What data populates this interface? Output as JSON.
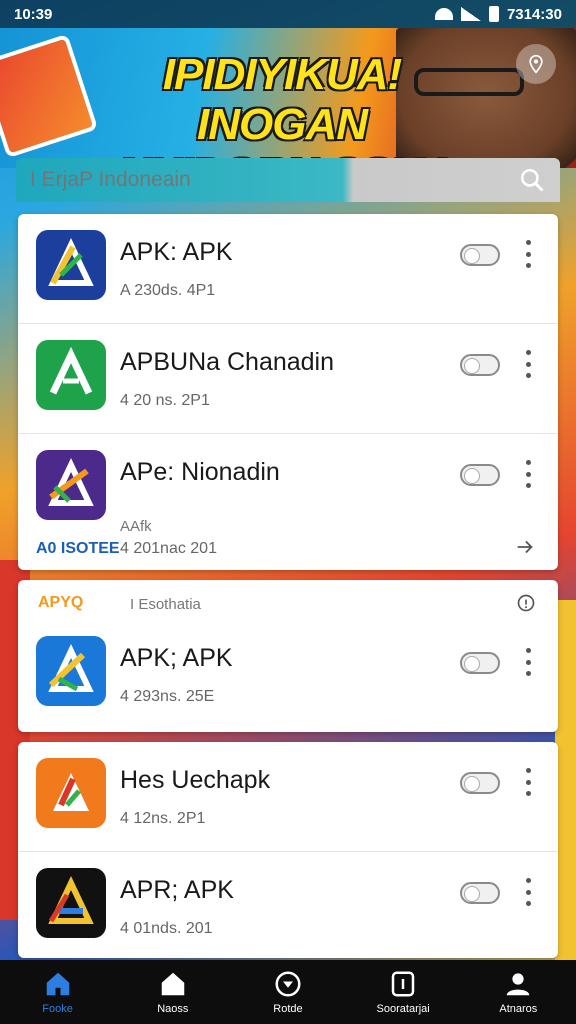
{
  "status_bar": {
    "time": "10:39",
    "right_time": "7314:30"
  },
  "banner": {
    "title_line1": "IPIDIYIKUA! INOGAN",
    "title_line2": "NUIDORN OSIA!"
  },
  "search": {
    "placeholder": "I ErjaP Indoneain"
  },
  "apps_group1": [
    {
      "name": "APK: APK",
      "meta": "A 230ds. 4P1",
      "toggle": false
    },
    {
      "name": "APBUNa Chanadin",
      "meta": "4 20 ns. 2P1",
      "toggle": false
    },
    {
      "name": "APe: Nionadin",
      "sub": "AAfk",
      "meta": "4 201nac 201",
      "toggle": false,
      "promo": "A0 ISOTEE"
    }
  ],
  "section": {
    "badge": "APYQ",
    "title": "I Esothatia"
  },
  "apps_group2": [
    {
      "name": "APK; APK",
      "meta": "4 293ns. 25E",
      "toggle": false
    }
  ],
  "apps_group3": [
    {
      "name": "Hes Uechapk",
      "meta": "4 12ns. 2P1",
      "toggle": false
    },
    {
      "name": "APR; APK",
      "meta": "4 01nds. 201",
      "toggle": false
    }
  ],
  "nav": [
    {
      "label": "Fooke",
      "icon": "home-icon",
      "active": true
    },
    {
      "label": "Naoss",
      "icon": "home-outline-icon",
      "active": false
    },
    {
      "label": "Rotde",
      "icon": "circle-app-icon",
      "active": false
    },
    {
      "label": "Sooratarjai",
      "icon": "square-one-icon",
      "active": false
    },
    {
      "label": "Atnaros",
      "icon": "user-icon",
      "active": false
    }
  ],
  "colors": {
    "accent": "#2d7ee0",
    "banner_yellow": "#ffe21a",
    "search_teal": "#1fa7bd"
  }
}
